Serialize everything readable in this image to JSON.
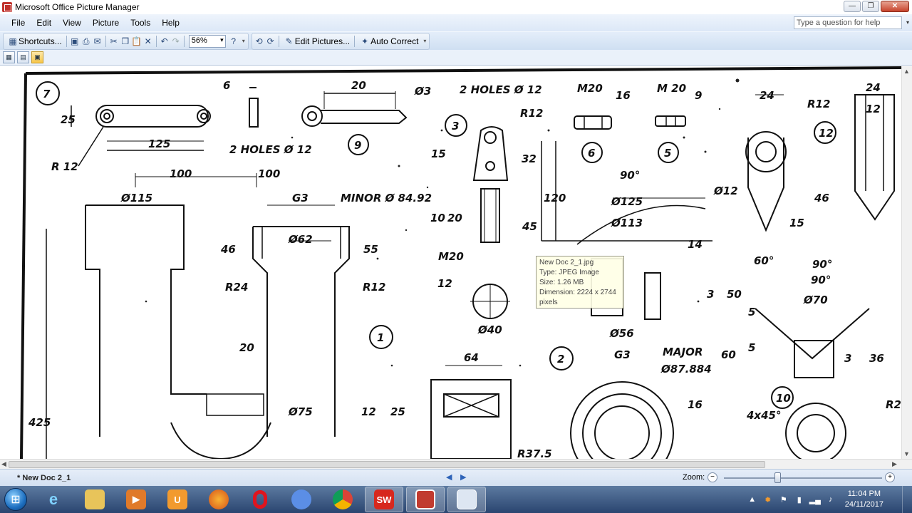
{
  "window": {
    "title": "Microsoft Office Picture Manager"
  },
  "window_controls": {
    "minimize": "—",
    "maximize": "❐",
    "close": "✕"
  },
  "menu": [
    "File",
    "Edit",
    "View",
    "Picture",
    "Tools",
    "Help"
  ],
  "help_box": {
    "placeholder": "Type a question for help"
  },
  "toolbar": {
    "shortcuts_label": "Shortcuts...",
    "zoom_value": "56%",
    "edit_pictures_label": "Edit Pictures...",
    "auto_correct_label": "Auto Correct"
  },
  "tooltip": {
    "name": "New Doc 2_1.jpg",
    "type": "Type: JPEG Image",
    "size": "Size: 1.26 MB",
    "dimension": "Dimension: 2224 x 2744",
    "dimension_unit": "pixels"
  },
  "drawing_labels": {
    "n7": "7",
    "n9": "9",
    "n3": "3",
    "n6": "6",
    "n5": "5",
    "n12": "12",
    "n1": "1",
    "n2": "2",
    "n10": "10",
    "r12_a": "R 12",
    "d125": "125",
    "d6": "6",
    "d20": "20",
    "d3": "Ø3",
    "holes_a": "2 HOLES Ø 12",
    "holes_b": "2 HOLES Ø 12",
    "r12_b": "R12",
    "m20_a": "M20",
    "d16": "16",
    "m20_b": "M 20",
    "d9": "9",
    "d24_a": "24",
    "r12_c": "R12",
    "d24_b": "24",
    "d12_a": "12",
    "d100_a": "100",
    "d100_b": "100",
    "d115": "Ø115",
    "g3_a": "G3",
    "minor": "MINOR Ø 84.92",
    "d62": "Ø62",
    "d46": "46",
    "d55": "55",
    "d32": "32",
    "d120": "120",
    "d15": "15",
    "d10": "10",
    "d20b": "20",
    "d45": "45",
    "m20_c": "M20",
    "d90_a": "90°",
    "d125b": "Ø125",
    "d113": "Ø113",
    "d12b": "Ø12",
    "d46b": "46",
    "d15b": "15",
    "d60": "60°",
    "d14": "14",
    "r24": "R24",
    "r12_d": "R12",
    "d12c": "12",
    "d40": "Ø40",
    "d50": "50",
    "d3b": "3",
    "d90_b": "90°",
    "d70": "Ø70",
    "d90_c": "90°",
    "d56": "Ø56",
    "g3_b": "G3",
    "major": "MAJOR",
    "d87": "Ø87.884",
    "d60b": "60",
    "d5a": "5",
    "d5b": "5",
    "d36": "36",
    "d3c": "3",
    "d20c": "20",
    "d64": "64",
    "d25": "25",
    "d425": "425",
    "d75": "Ø75",
    "d12d": "12",
    "d16b": "16",
    "d4x45": "4x45°",
    "r2": "R2",
    "r375": "R37.5",
    "d25b": "25"
  },
  "status": {
    "doc_name": "* New Doc 2_1",
    "zoom_label": "Zoom:",
    "zoom_level": 0.34
  },
  "taskbar": {
    "apps": [
      "start-orb",
      "internet-explorer",
      "file-explorer",
      "media-player",
      "uc-browser",
      "firefox",
      "opera",
      "chromium",
      "chrome",
      "solidworks",
      "picture-manager",
      "taskbar-folder"
    ],
    "sw_label": "SW",
    "time": "11:04 PM",
    "date": "24/11/2017"
  }
}
